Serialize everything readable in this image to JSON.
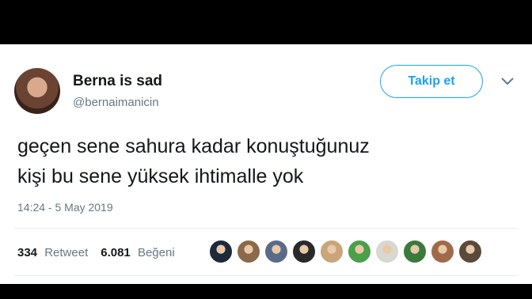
{
  "tweet": {
    "author": {
      "name": "Berna is sad",
      "handle": "@bernaimanicin"
    },
    "follow_label": "Takip et",
    "text_lines": [
      "geçen sene sahura kadar konuştuğunuz",
      "kişi bu sene yüksek ihtimalle yok"
    ],
    "timestamp": "14:24 - 5 May 2019",
    "stats": {
      "retweets": "334",
      "retweets_label": "Retweet",
      "likes": "6.081",
      "likes_label": "Beğeni"
    },
    "liker_avatars": [
      "#1c2a3a",
      "#8a6a4a",
      "#5a6b8a",
      "#2a2a2a",
      "#c9a57a",
      "#4aa04a",
      "#d8d8d0",
      "#3a7a3a",
      "#a06a4a",
      "#5a4a3a"
    ]
  },
  "colors": {
    "accent": "#1da1f2",
    "text": "#14171a",
    "secondary": "#657786"
  },
  "icons": {
    "caret": "chevron-down-icon"
  }
}
